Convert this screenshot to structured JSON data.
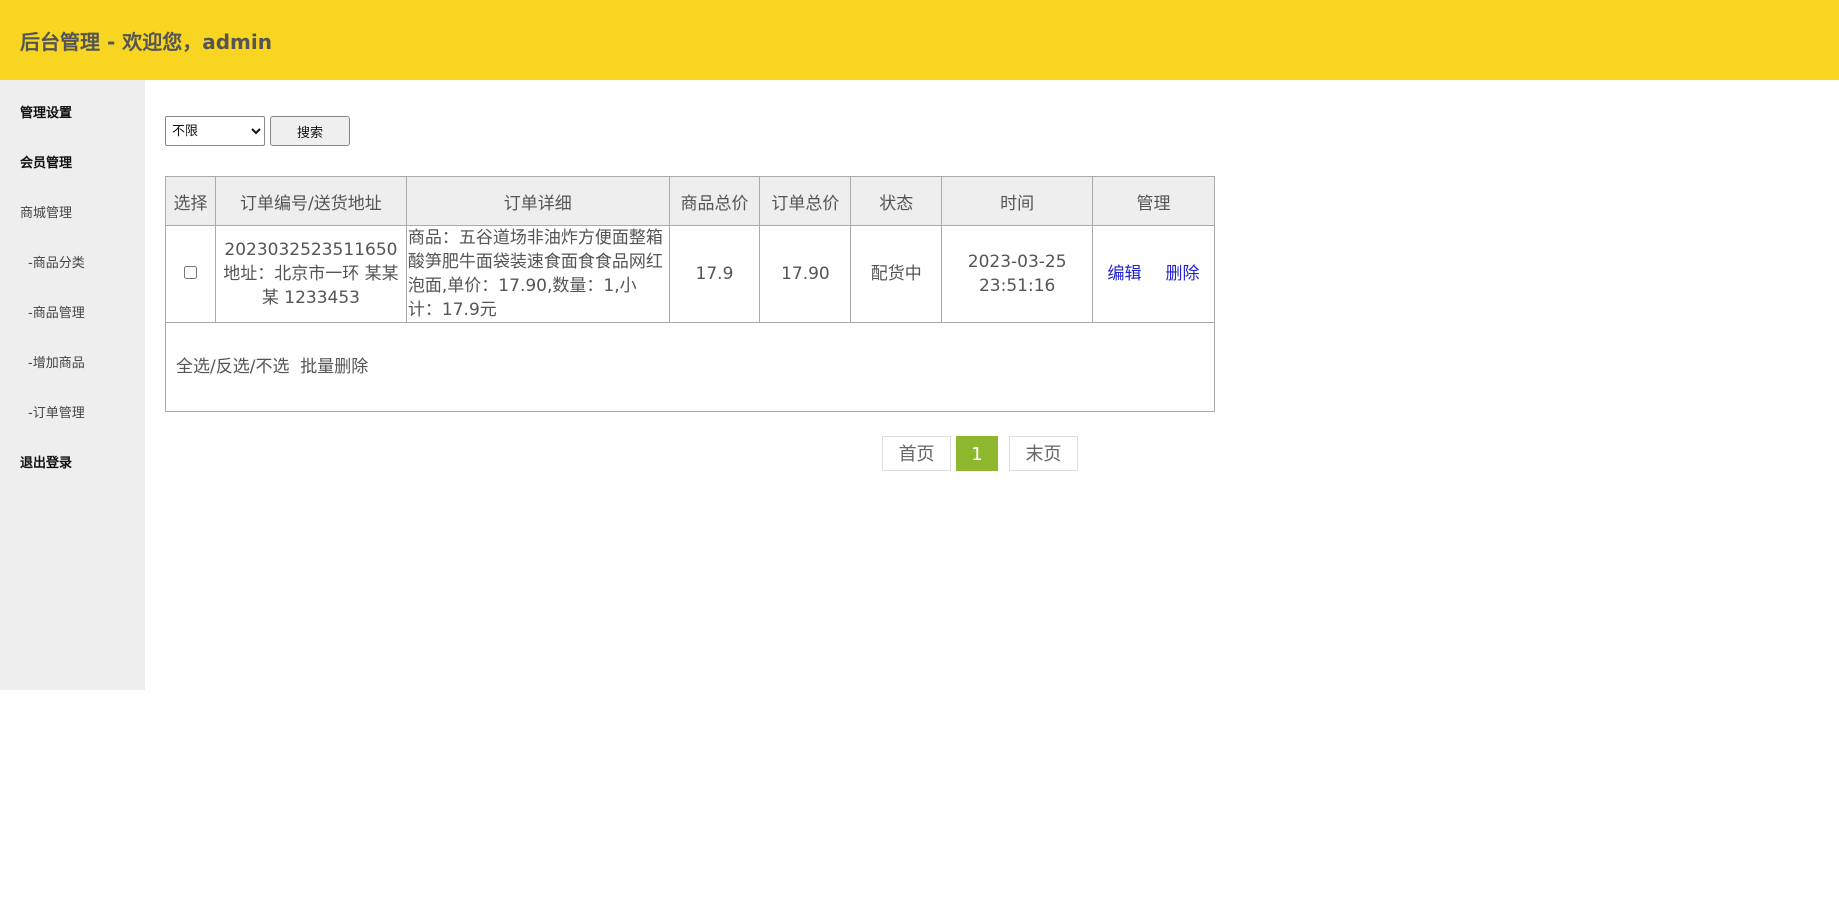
{
  "header": {
    "title": "后台管理 - 欢迎您，admin"
  },
  "sidebar": {
    "items": [
      {
        "label": "管理设置"
      },
      {
        "label": "会员管理"
      },
      {
        "label": "商城管理"
      },
      {
        "label": "-商品分类"
      },
      {
        "label": "-商品管理"
      },
      {
        "label": "-增加商品"
      },
      {
        "label": "-订单管理"
      },
      {
        "label": "退出登录"
      }
    ]
  },
  "search": {
    "select_value": "不限",
    "button_label": "搜索"
  },
  "table": {
    "headers": [
      "选择",
      "订单编号/送货地址",
      "订单详细",
      "商品总价",
      "订单总价",
      "状态",
      "时间",
      "管理"
    ],
    "rows": [
      {
        "order_no": "2023032523511650",
        "address": "地址：北京市一环 某某某 1233453",
        "detail": "商品：五谷道场非油炸方便面整箱酸笋肥牛面袋装速食面食食品网红泡面,单价：17.90,数量：1,小计：17.9元",
        "goods_total": "17.9",
        "order_total": "17.90",
        "status": "配货中",
        "date": "2023-03-25",
        "time": "23:51:16",
        "edit_label": "编辑",
        "delete_label": "删除"
      }
    ],
    "footer": {
      "select_all": "全选",
      "invert": "反选",
      "none": "不选",
      "batch_delete": "批量删除"
    }
  },
  "pagination": {
    "first": "首页",
    "current": "1",
    "last": "末页"
  }
}
